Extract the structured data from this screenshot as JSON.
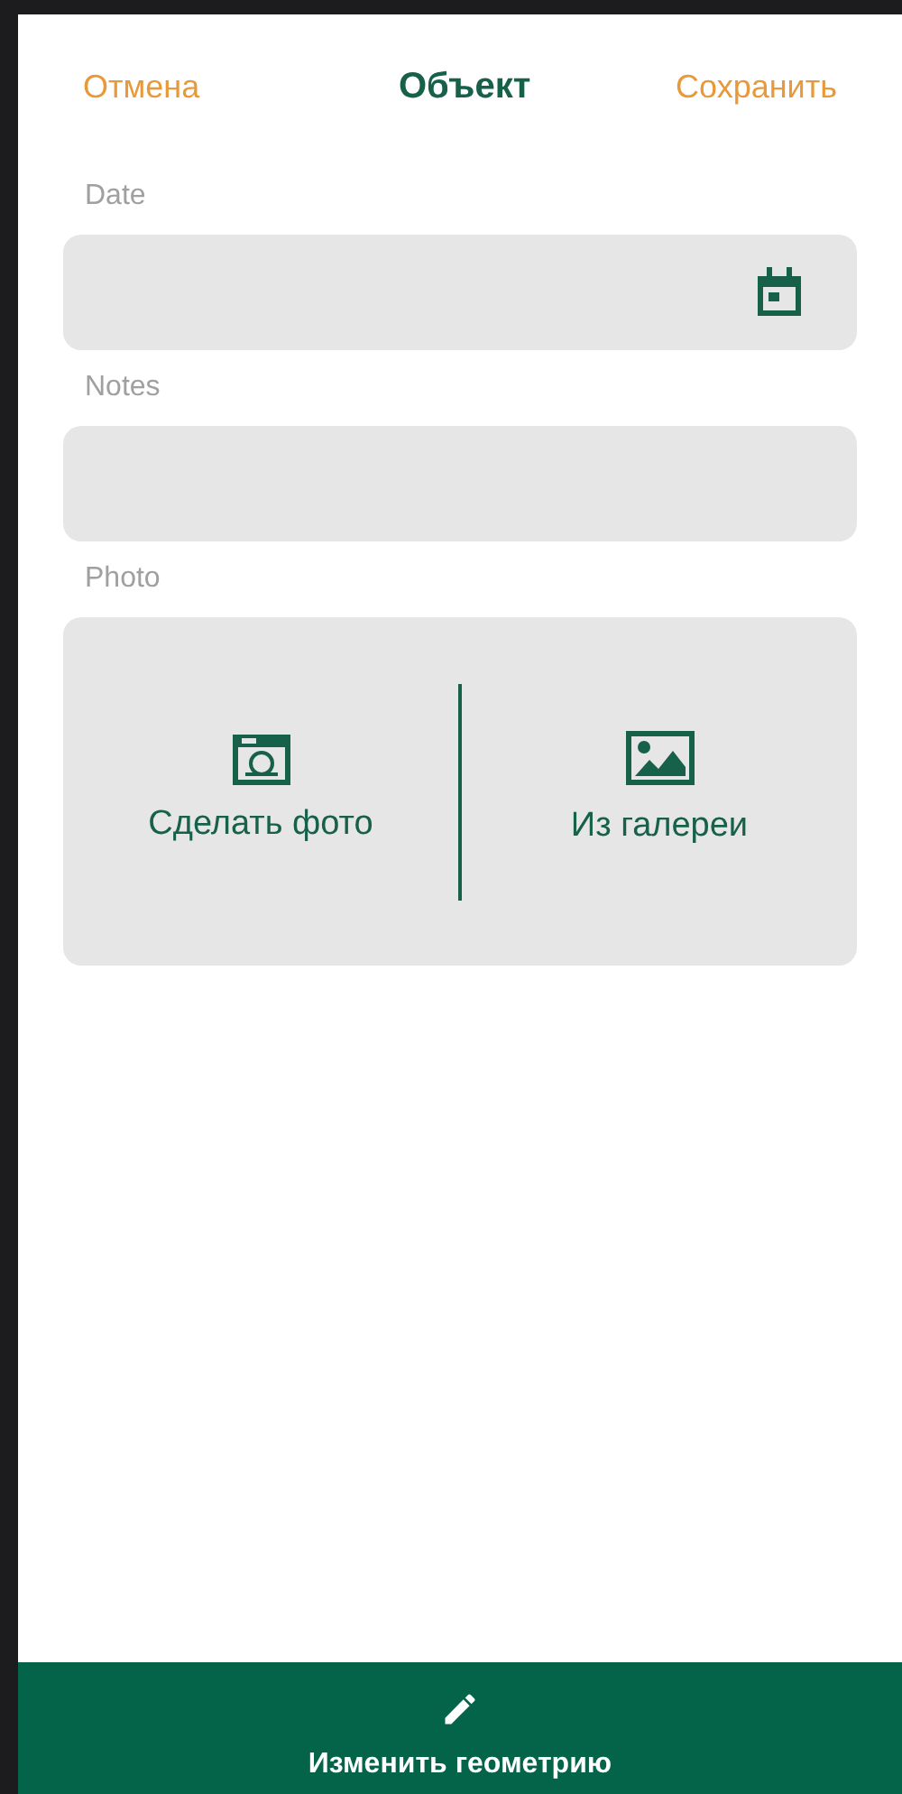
{
  "header": {
    "cancel": "Отмена",
    "title": "Объект",
    "save": "Сохранить"
  },
  "fields": [
    {
      "kind": "date",
      "label": "Date"
    },
    {
      "kind": "text",
      "label": "Notes"
    },
    {
      "kind": "photo",
      "label": "Photo",
      "options": [
        {
          "kind": "camera",
          "label": "Сделать фото"
        },
        {
          "kind": "gallery",
          "label": "Из галереи"
        }
      ]
    }
  ],
  "bottom_button": {
    "label": "Изменить геометрию"
  }
}
